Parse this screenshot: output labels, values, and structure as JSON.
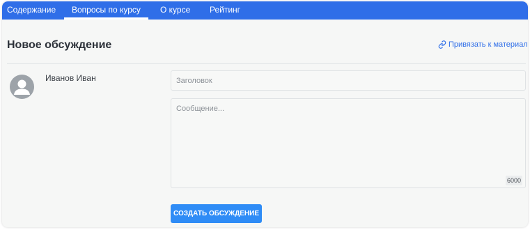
{
  "tabs": [
    {
      "label": "Содержание",
      "active": false
    },
    {
      "label": "Вопросы по курсу",
      "active": true
    },
    {
      "label": "О курсе",
      "active": false
    },
    {
      "label": "Рейтинг",
      "active": false
    }
  ],
  "discussion": {
    "title": "Новое обсуждение",
    "attach_label": "Привязать к материалу",
    "author": "Иванов Иван",
    "title_placeholder": "Заголовок",
    "message_placeholder": "Сообщение...",
    "char_limit": "6000",
    "submit_label": "СОЗДАТЬ ОБСУЖДЕНИЕ"
  },
  "colors": {
    "accent": "#2f6ee8",
    "button": "#2f8cf6",
    "avatar": "#9da3a9"
  }
}
